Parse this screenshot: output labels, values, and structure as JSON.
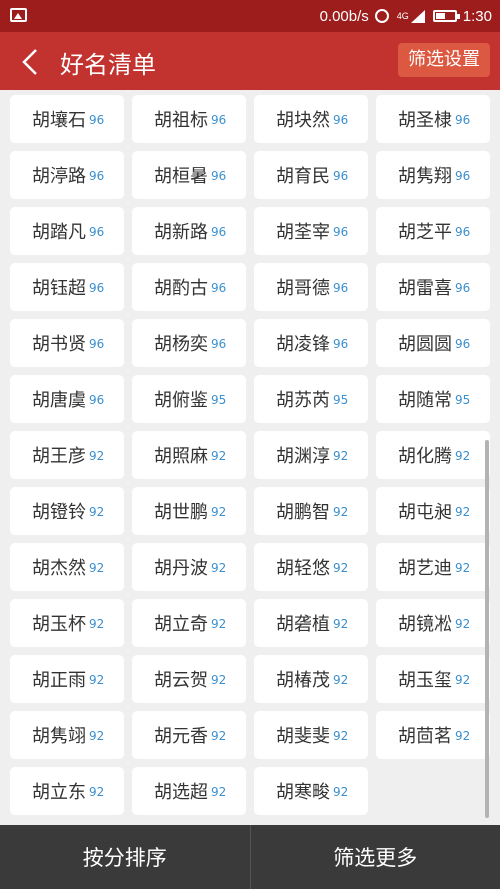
{
  "status_bar": {
    "network_speed": "0.00b/s",
    "network_type": "4G",
    "time": "1:30"
  },
  "header": {
    "title": "好名清单",
    "filter_button": "筛选设置"
  },
  "names": [
    {
      "name": "胡壤石",
      "score": "96"
    },
    {
      "name": "胡祖标",
      "score": "96"
    },
    {
      "name": "胡块然",
      "score": "96"
    },
    {
      "name": "胡圣棣",
      "score": "96"
    },
    {
      "name": "胡渟路",
      "score": "96"
    },
    {
      "name": "胡桓暑",
      "score": "96"
    },
    {
      "name": "胡育民",
      "score": "96"
    },
    {
      "name": "胡隽翔",
      "score": "96"
    },
    {
      "name": "胡踏凡",
      "score": "96"
    },
    {
      "name": "胡新路",
      "score": "96"
    },
    {
      "name": "胡荃宰",
      "score": "96"
    },
    {
      "name": "胡芝平",
      "score": "96"
    },
    {
      "name": "胡钰超",
      "score": "96"
    },
    {
      "name": "胡酌古",
      "score": "96"
    },
    {
      "name": "胡哥德",
      "score": "96"
    },
    {
      "name": "胡雷喜",
      "score": "96"
    },
    {
      "name": "胡书贤",
      "score": "96"
    },
    {
      "name": "胡杨奕",
      "score": "96"
    },
    {
      "name": "胡凌锋",
      "score": "96"
    },
    {
      "name": "胡圆圆",
      "score": "96"
    },
    {
      "name": "胡唐虞",
      "score": "96"
    },
    {
      "name": "胡俯鉴",
      "score": "95"
    },
    {
      "name": "胡苏芮",
      "score": "95"
    },
    {
      "name": "胡随常",
      "score": "95"
    },
    {
      "name": "胡王彦",
      "score": "92"
    },
    {
      "name": "胡照麻",
      "score": "92"
    },
    {
      "name": "胡渊淳",
      "score": "92"
    },
    {
      "name": "胡化腾",
      "score": "92"
    },
    {
      "name": "胡镫铃",
      "score": "92"
    },
    {
      "name": "胡世鹏",
      "score": "92"
    },
    {
      "name": "胡鹏智",
      "score": "92"
    },
    {
      "name": "胡屯昶",
      "score": "92"
    },
    {
      "name": "胡杰然",
      "score": "92"
    },
    {
      "name": "胡丹波",
      "score": "92"
    },
    {
      "name": "胡轻悠",
      "score": "92"
    },
    {
      "name": "胡艺迪",
      "score": "92"
    },
    {
      "name": "胡玉杯",
      "score": "92"
    },
    {
      "name": "胡立奇",
      "score": "92"
    },
    {
      "name": "胡砻植",
      "score": "92"
    },
    {
      "name": "胡镜凇",
      "score": "92"
    },
    {
      "name": "胡正雨",
      "score": "92"
    },
    {
      "name": "胡云贺",
      "score": "92"
    },
    {
      "name": "胡椿茂",
      "score": "92"
    },
    {
      "name": "胡玉玺",
      "score": "92"
    },
    {
      "name": "胡隽翊",
      "score": "92"
    },
    {
      "name": "胡元香",
      "score": "92"
    },
    {
      "name": "胡斐斐",
      "score": "92"
    },
    {
      "name": "胡茴茗",
      "score": "92"
    },
    {
      "name": "胡立东",
      "score": "92"
    },
    {
      "name": "胡选超",
      "score": "92"
    },
    {
      "name": "胡寒畯",
      "score": "92"
    }
  ],
  "bottom_bar": {
    "sort_button": "按分排序",
    "more_filter_button": "筛选更多"
  },
  "colors": {
    "status_bar": "#9d1d1d",
    "header": "#c2322f",
    "filter_button": "#dc5840",
    "score": "#3a8fd0",
    "bottom_bar": "#3a3a3a"
  }
}
